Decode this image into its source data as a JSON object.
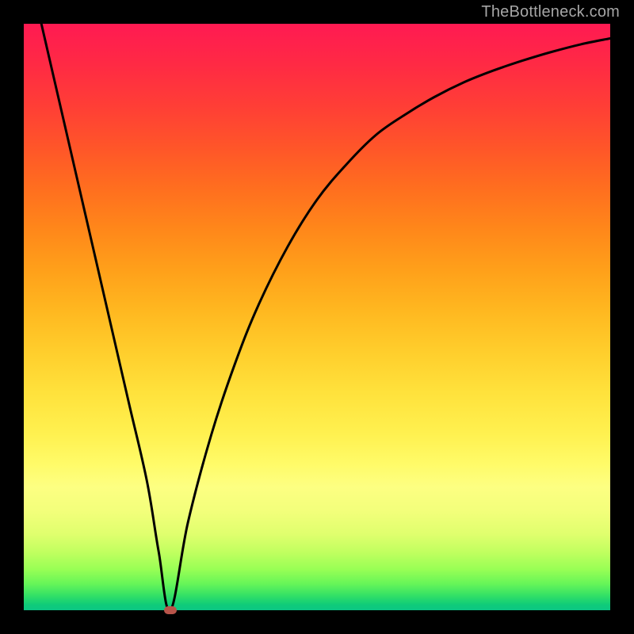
{
  "watermark": "TheBottleneck.com",
  "chart_data": {
    "type": "line",
    "title": "",
    "xlabel": "",
    "ylabel": "",
    "xlim": [
      0,
      100
    ],
    "ylim": [
      0,
      100
    ],
    "background_gradient_meaning": "bottleneck-severity-low-green-to-high-red",
    "series": [
      {
        "name": "bottleneck-curve",
        "x": [
          3,
          6,
          9,
          12,
          15,
          18,
          21,
          23,
          25,
          28,
          32,
          36,
          40,
          45,
          50,
          55,
          60,
          65,
          70,
          75,
          80,
          85,
          90,
          95,
          100
        ],
        "values": [
          100,
          87,
          74,
          61,
          48,
          35,
          22,
          10,
          0,
          15,
          30,
          42,
          52,
          62,
          70,
          76,
          81,
          84.5,
          87.5,
          90,
          92,
          93.7,
          95.2,
          96.5,
          97.5
        ]
      }
    ],
    "min_point": {
      "x": 25,
      "y": 0
    },
    "annotations": []
  }
}
